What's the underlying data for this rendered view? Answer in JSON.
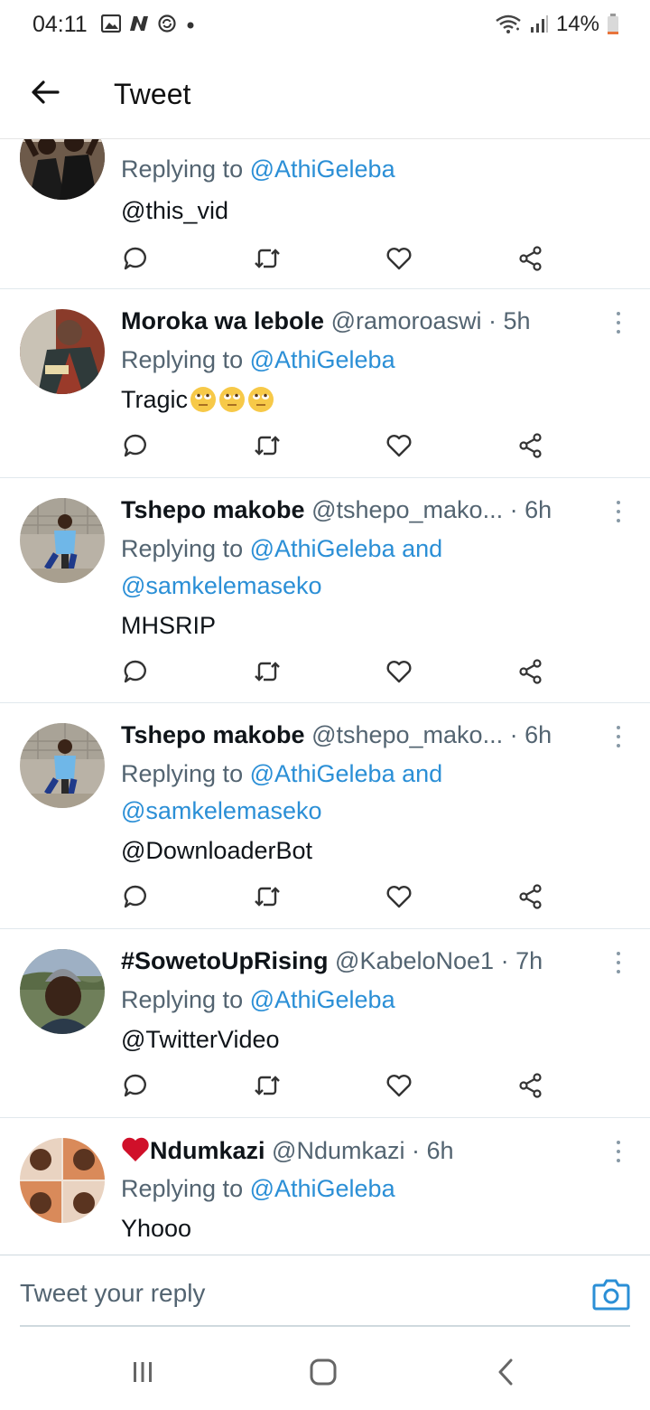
{
  "status_bar": {
    "time": "04:11",
    "battery_percent": "14%",
    "battery_level": 0.14,
    "left_icons": [
      "gallery-icon",
      "n-logo-icon",
      "sync-icon",
      "dot-icon"
    ],
    "right_icons": [
      "wifi-icon",
      "signal-icon",
      "battery-icon"
    ]
  },
  "header": {
    "title": "Tweet",
    "back_icon": "back-arrow-icon"
  },
  "tweets": [
    {
      "replying_prefix": "Replying to ",
      "replying_to": "@AthiGeleba",
      "text_link": "@this_vid"
    },
    {
      "name": "Moroka wa lebole",
      "handle": "@ramoroaswi",
      "time": "· 5h",
      "replying_prefix": "Replying to ",
      "replying_to": "@AthiGeleba",
      "text": "Tragic",
      "emoji_count": 3
    },
    {
      "name": "Tshepo makobe",
      "handle": "@tshepo_mako...",
      "time": "· 6h",
      "replying_prefix": "Replying to ",
      "replying_to": "@AthiGeleba",
      "replying_and": " and",
      "replying_to_2": "@samkelemaseko",
      "text": "MHSRIP"
    },
    {
      "name": "Tshepo makobe",
      "handle": "@tshepo_mako...",
      "time": "· 6h",
      "replying_prefix": "Replying to ",
      "replying_to": "@AthiGeleba",
      "replying_and": " and",
      "replying_to_2": "@samkelemaseko",
      "text_link": "@DownloaderBot"
    },
    {
      "name": "#SowetoUpRising",
      "handle": "@KabeloNoe1",
      "time": "· 7h",
      "replying_prefix": "Replying to ",
      "replying_to": "@AthiGeleba",
      "text_link": "@TwitterVideo"
    },
    {
      "name": "Ndumkazi",
      "handle": "@Ndumkazi",
      "time": "· 6h",
      "replying_prefix": "Replying to ",
      "replying_to": "@AthiGeleba",
      "text": "Yhooo"
    }
  ],
  "action_icons": [
    "reply-icon",
    "retweet-icon",
    "like-icon",
    "share-icon"
  ],
  "reply_bar": {
    "placeholder": "Tweet your reply"
  },
  "colors": {
    "link": "#2b8fd6",
    "heart": "#e0245e"
  }
}
